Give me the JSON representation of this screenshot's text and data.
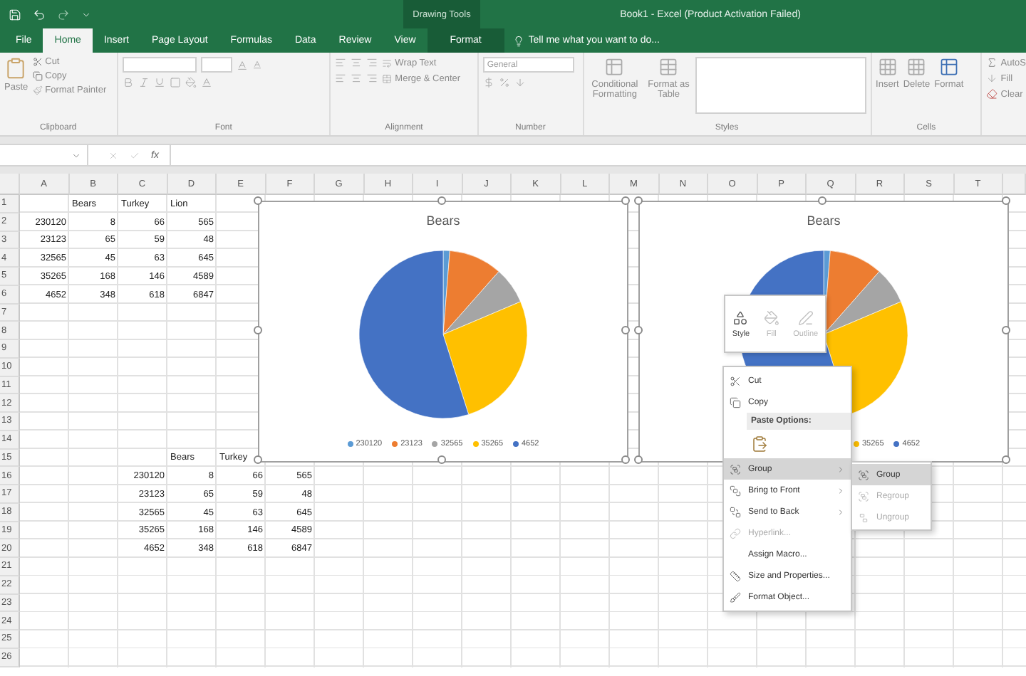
{
  "title_bar": {
    "contextual_group": "Drawing Tools",
    "title": "Book1 - Excel (Product Activation Failed)"
  },
  "tabs": [
    {
      "label": "File",
      "selected": false,
      "kind": "normal"
    },
    {
      "label": "Home",
      "selected": true,
      "kind": "normal"
    },
    {
      "label": "Insert",
      "selected": false,
      "kind": "normal"
    },
    {
      "label": "Page Layout",
      "selected": false,
      "kind": "normal"
    },
    {
      "label": "Formulas",
      "selected": false,
      "kind": "normal"
    },
    {
      "label": "Data",
      "selected": false,
      "kind": "normal"
    },
    {
      "label": "Review",
      "selected": false,
      "kind": "normal"
    },
    {
      "label": "View",
      "selected": false,
      "kind": "normal"
    },
    {
      "label": "Format",
      "selected": false,
      "kind": "contextual"
    }
  ],
  "tell_me": {
    "placeholder": "Tell me what you want to do..."
  },
  "ribbon": {
    "clipboard": {
      "label": "Clipboard",
      "paste": "Paste",
      "cut": "Cut",
      "copy": "Copy",
      "format_painter": "Format Painter"
    },
    "font": {
      "label": "Font"
    },
    "alignment": {
      "label": "Alignment",
      "wrap_text": "Wrap Text",
      "merge_center": "Merge & Center"
    },
    "number": {
      "label": "Number",
      "format": "General"
    },
    "styles": {
      "label": "Styles",
      "conditional_formatting": "Conditional Formatting",
      "format_as_table": "Format as Table"
    },
    "cells": {
      "label": "Cells",
      "insert": "Insert",
      "delete": "Delete",
      "format": "Format"
    },
    "editing": {
      "autosum": "AutoS",
      "fill": "Fill",
      "clear": "Clear"
    }
  },
  "formula_bar": {
    "function_label": "fx"
  },
  "sheet": {
    "columns": [
      "A",
      "B",
      "C",
      "D",
      "E",
      "F",
      "G",
      "H",
      "I",
      "J",
      "K",
      "L",
      "M",
      "N",
      "O",
      "P",
      "Q",
      "R",
      "S",
      "T"
    ],
    "rows": [
      {
        "label": "1",
        "kind": "header",
        "cells": [
          null,
          "Bears",
          "Turkey",
          "Lion"
        ]
      },
      {
        "label": "2",
        "kind": "data",
        "cells": [
          "230120",
          "8",
          "66",
          "565"
        ]
      },
      {
        "label": "3",
        "kind": "data",
        "cells": [
          "23123",
          "65",
          "59",
          "48"
        ]
      },
      {
        "label": "4",
        "kind": "data",
        "cells": [
          "32565",
          "45",
          "63",
          "645"
        ]
      },
      {
        "label": "5",
        "kind": "data",
        "cells": [
          "35265",
          "168",
          "146",
          "4589"
        ]
      },
      {
        "label": "6",
        "kind": "data",
        "cells": [
          "4652",
          "348",
          "618",
          "6847"
        ]
      },
      {
        "label": "7"
      },
      {
        "label": "8"
      },
      {
        "label": "9"
      },
      {
        "label": "10"
      },
      {
        "label": "11"
      },
      {
        "label": "12"
      },
      {
        "label": "13"
      },
      {
        "label": "14"
      },
      {
        "label": "15",
        "kind": "header",
        "cells": [
          null,
          null,
          null,
          "Bears",
          "Turkey"
        ]
      },
      {
        "label": "16",
        "kind": "data",
        "cells": [
          null,
          null,
          "230120",
          "8",
          "66",
          "565"
        ]
      },
      {
        "label": "17",
        "kind": "data",
        "cells": [
          null,
          null,
          "23123",
          "65",
          "59",
          "48"
        ]
      },
      {
        "label": "18",
        "kind": "data",
        "cells": [
          null,
          null,
          "32565",
          "45",
          "63",
          "645"
        ]
      },
      {
        "label": "19",
        "kind": "data",
        "cells": [
          null,
          null,
          "35265",
          "168",
          "146",
          "4589"
        ]
      },
      {
        "label": "20",
        "kind": "data",
        "cells": [
          null,
          null,
          "4652",
          "348",
          "618",
          "6847"
        ]
      },
      {
        "label": "21"
      },
      {
        "label": "22"
      },
      {
        "label": "23"
      },
      {
        "label": "24"
      },
      {
        "label": "25"
      },
      {
        "label": "26"
      }
    ]
  },
  "charts": [
    {
      "selected": true,
      "slices": [
        {
          "color": "#5b9bd5"
        },
        {
          "color": "#ed7d31"
        },
        {
          "color": "#a5a5a5"
        },
        {
          "color": "#ffc000"
        },
        {
          "color": "#4472c4"
        }
      ],
      "chart_data": {
        "type": "pie",
        "title": "Bears",
        "categories": [
          "230120",
          "23123",
          "32565",
          "35265",
          "4652"
        ],
        "series": [
          {
            "values": [
              1.26,
              10.25,
              7.1,
              26.5,
              54.89
            ]
          }
        ]
      }
    },
    {
      "selected": true,
      "title": "Bears",
      "slices": [
        {
          "color": "#5b9bd5"
        },
        {
          "color": "#ed7d31"
        },
        {
          "color": "#a5a5a5"
        },
        {
          "color": "#ffc000"
        },
        {
          "color": "#4472c4"
        }
      ],
      "legend": [
        {
          "label": "35265",
          "color": "#ffc000"
        },
        {
          "label": "4652",
          "color": "#4472c4"
        }
      ]
    }
  ],
  "mini_toolbar": [
    {
      "label": "Style",
      "disabled": false
    },
    {
      "label": "Fill",
      "disabled": true
    },
    {
      "label": "Outline",
      "disabled": true
    }
  ],
  "context_menu": [
    {
      "label": "Cut",
      "kind": "item",
      "disabled": false,
      "selected": false,
      "submenu": false
    },
    {
      "label": "Copy",
      "kind": "item",
      "disabled": false,
      "selected": false,
      "submenu": false
    },
    {
      "label": "Paste Options:",
      "kind": "header"
    },
    {
      "kind": "paste_row"
    },
    {
      "label": "Group",
      "kind": "item",
      "disabled": false,
      "selected": true,
      "submenu": true
    },
    {
      "label": "Bring to Front",
      "kind": "item",
      "disabled": false,
      "selected": false,
      "submenu": true
    },
    {
      "label": "Send to Back",
      "kind": "item",
      "disabled": false,
      "selected": false,
      "submenu": true
    },
    {
      "label": "Hyperlink...",
      "kind": "item",
      "disabled": true,
      "selected": false,
      "submenu": false
    },
    {
      "label": "Assign Macro...",
      "kind": "item",
      "disabled": false,
      "selected": false,
      "submenu": false
    },
    {
      "label": "Size and Properties...",
      "kind": "item",
      "disabled": false,
      "selected": false,
      "submenu": false
    },
    {
      "label": "Format Object...",
      "kind": "item",
      "disabled": false,
      "selected": false,
      "submenu": false
    }
  ],
  "submenu": [
    {
      "label": "Group",
      "disabled": false,
      "selected": true
    },
    {
      "label": "Regroup",
      "disabled": true,
      "selected": false
    },
    {
      "label": "Ungroup",
      "disabled": true,
      "selected": false
    }
  ]
}
